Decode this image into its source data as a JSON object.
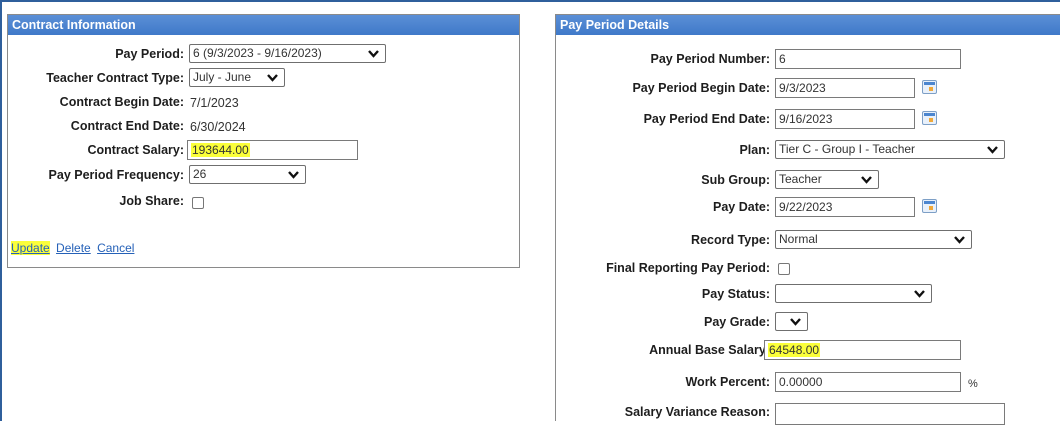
{
  "contract": {
    "header": "Contract Information",
    "pay_period_label": "Pay Period:",
    "pay_period_value": "6 (9/3/2023 - 9/16/2023)",
    "teacher_contract_type_label": "Teacher Contract Type:",
    "teacher_contract_type_value": "July - June",
    "contract_begin_label": "Contract Begin Date:",
    "contract_begin_value": "7/1/2023",
    "contract_end_label": "Contract End Date:",
    "contract_end_value": "6/30/2024",
    "contract_salary_label": "Contract Salary:",
    "contract_salary_value": "193644.00",
    "pay_frequency_label": "Pay Period Frequency:",
    "pay_frequency_value": "26",
    "job_share_label": "Job Share:",
    "links": {
      "update": "Update",
      "delete": "Delete",
      "cancel": "Cancel"
    }
  },
  "pay_period": {
    "header": "Pay Period Details",
    "number_label": "Pay Period Number:",
    "number_value": "6",
    "begin_label": "Pay Period Begin Date:",
    "begin_value": "9/3/2023",
    "end_label": "Pay Period End Date:",
    "end_value": "9/16/2023",
    "plan_label": "Plan:",
    "plan_value": "Tier C - Group I - Teacher",
    "sub_group_label": "Sub Group:",
    "sub_group_value": "Teacher",
    "pay_date_label": "Pay Date:",
    "pay_date_value": "9/22/2023",
    "record_type_label": "Record Type:",
    "record_type_value": "Normal",
    "final_reporting_label": "Final Reporting Pay Period:",
    "pay_status_label": "Pay Status:",
    "pay_status_value": "",
    "pay_grade_label": "Pay Grade:",
    "pay_grade_value": "",
    "annual_base_label": "Annual Base Salary:",
    "annual_base_value": "64548.00",
    "work_percent_label": "Work Percent:",
    "work_percent_value": "0.00000",
    "work_percent_unit": "%",
    "salary_variance_label": "Salary Variance Reason:"
  },
  "colors": {
    "header_blue": "#3f79c9",
    "highlight": "#fbff3a",
    "link": "#2561b8"
  }
}
